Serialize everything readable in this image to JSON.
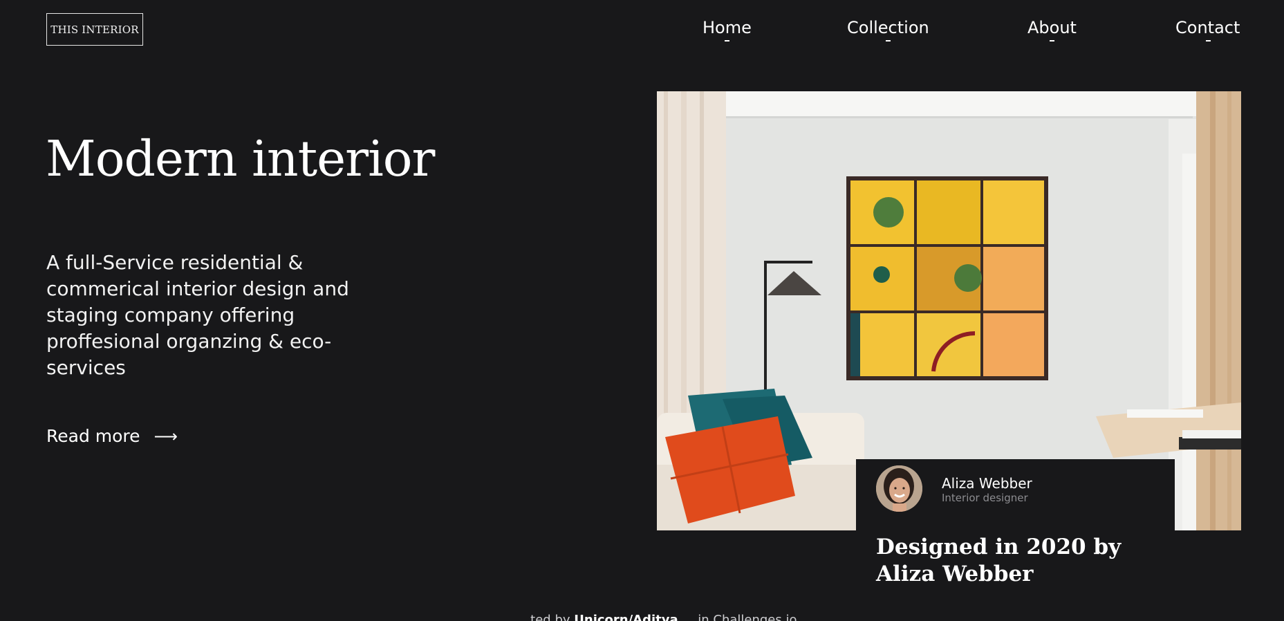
{
  "header": {
    "logo": "THIS INTERIOR",
    "nav": [
      {
        "label": "Home"
      },
      {
        "label": "Collection"
      },
      {
        "label": "About"
      },
      {
        "label": "Contact"
      }
    ]
  },
  "hero": {
    "title": "Modern interior",
    "description": "A full-Service residential & commerical interior design and staging company offering proffesional organzing & eco-services",
    "read_more": "Read more",
    "read_more_icon": "arrow-right-icon"
  },
  "designer_card": {
    "name": "Aliza Webber",
    "role": "Interior designer",
    "headline": "Designed in 2020 by Aliza Webber"
  },
  "footer": {
    "attribution_prefix": "...ted by",
    "attribution_author": "Unicorn/Aditya",
    "attribution_suffix": "... in Challenges.io"
  },
  "colors": {
    "background": "#18181a",
    "text": "#ffffff",
    "muted": "#8c8c90"
  }
}
